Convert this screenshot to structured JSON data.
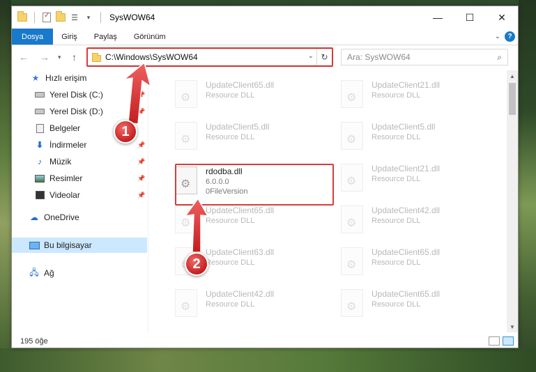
{
  "window": {
    "title": "SysWOW64",
    "controls": {
      "minimize": "—",
      "maximize": "☐",
      "close": "✕"
    }
  },
  "ribbon": {
    "tabs": [
      "Dosya",
      "Giriş",
      "Paylaş",
      "Görünüm"
    ]
  },
  "address": {
    "path": "C:\\Windows\\SysWOW64",
    "search_placeholder": "Ara: SysWOW64"
  },
  "nav": {
    "items": [
      {
        "label": "Hızlı erişim",
        "icon": "star-icon"
      },
      {
        "label": "Yerel Disk (C:)",
        "icon": "drive-icon"
      },
      {
        "label": "Yerel Disk (D:)",
        "icon": "drive-icon"
      },
      {
        "label": "Belgeler",
        "icon": "documents-icon"
      },
      {
        "label": "İndirmeler",
        "icon": "downloads-icon"
      },
      {
        "label": "Müzik",
        "icon": "music-icon"
      },
      {
        "label": "Resimler",
        "icon": "pictures-icon"
      },
      {
        "label": "Videolar",
        "icon": "videos-icon"
      },
      {
        "label": "OneDrive",
        "icon": "onedrive-icon"
      },
      {
        "label": "Bu bilgisayar",
        "icon": "this-pc-icon"
      },
      {
        "label": "Ağ",
        "icon": "network-icon"
      }
    ]
  },
  "files": [
    {
      "name": "UpdateClient65.dll",
      "desc": "Resource DLL"
    },
    {
      "name": "UpdateClient21.dll",
      "desc": "Resource DLL"
    },
    {
      "name": "UpdateClient5.dll",
      "desc": "Resource DLL"
    },
    {
      "name": "UpdateClient5.dll",
      "desc": "Resource DLL"
    },
    {
      "name": "rdodba.dll",
      "version": "6.0.0.0",
      "desc": "0FileVersion"
    },
    {
      "name": "UpdateClient21.dll",
      "desc": "Resource DLL"
    },
    {
      "name": "UpdateClient65.dll",
      "desc": "Resource DLL"
    },
    {
      "name": "UpdateClient42.dll",
      "desc": "Resource DLL"
    },
    {
      "name": "UpdateClient63.dll",
      "desc": "Resource DLL"
    },
    {
      "name": "UpdateClient65.dll",
      "desc": "Resource DLL"
    },
    {
      "name": "UpdateClient42.dll",
      "desc": "Resource DLL"
    },
    {
      "name": "UpdateClient65.dll",
      "desc": "Resource DLL"
    }
  ],
  "status": {
    "count": "195 öğe"
  },
  "annotations": {
    "badge1": "1",
    "badge2": "2",
    "color": "#d93b3b"
  }
}
